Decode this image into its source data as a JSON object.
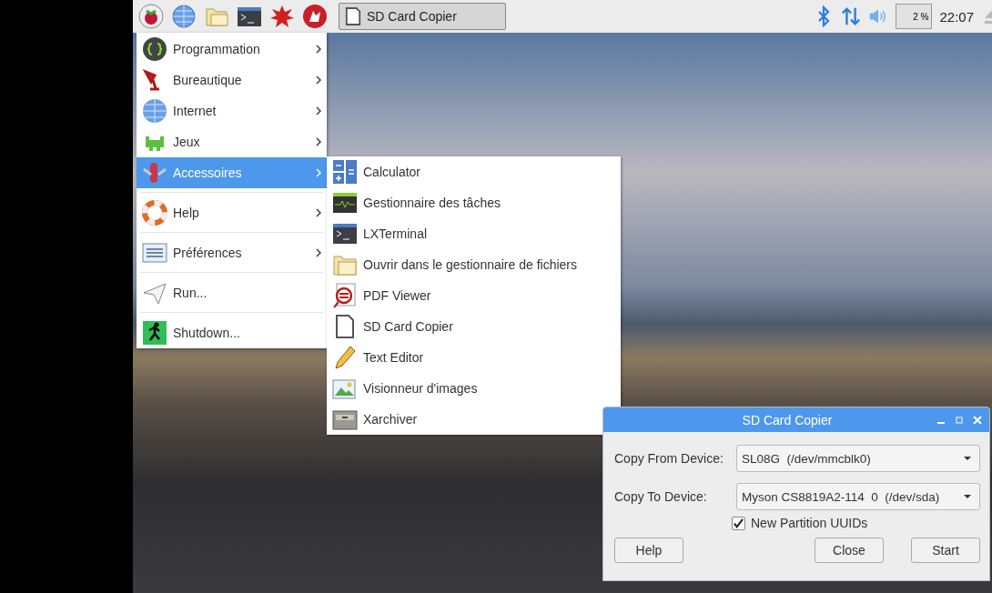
{
  "taskbar": {
    "task_button": {
      "label": "SD Card Copier",
      "selected": true
    },
    "cpu_monitor": {
      "reading": "2 %"
    },
    "clock": "22:07"
  },
  "main_menu": [
    {
      "label": "Programmation",
      "submenu": true,
      "selected": false,
      "separator_before": false
    },
    {
      "label": "Bureautique",
      "submenu": true,
      "selected": false,
      "separator_before": false
    },
    {
      "label": "Internet",
      "submenu": true,
      "selected": false,
      "separator_before": false
    },
    {
      "label": "Jeux",
      "submenu": true,
      "selected": false,
      "separator_before": false
    },
    {
      "label": "Accessoires",
      "submenu": true,
      "selected": true,
      "separator_before": false
    },
    {
      "label": "Help",
      "submenu": true,
      "selected": false,
      "separator_before": true
    },
    {
      "label": "Préférences",
      "submenu": true,
      "selected": false,
      "separator_before": true
    },
    {
      "label": "Run...",
      "submenu": false,
      "selected": false,
      "separator_before": true
    },
    {
      "label": "Shutdown...",
      "submenu": false,
      "selected": false,
      "separator_before": true
    }
  ],
  "submenu": [
    {
      "label": "Calculator"
    },
    {
      "label": "Gestionnaire des tâches"
    },
    {
      "label": "LXTerminal"
    },
    {
      "label": "Ouvrir dans le gestionnaire de fichiers"
    },
    {
      "label": "PDF Viewer"
    },
    {
      "label": "SD Card Copier"
    },
    {
      "label": "Text Editor"
    },
    {
      "label": "Visionneur d'images"
    },
    {
      "label": "Xarchiver"
    }
  ],
  "dialog": {
    "title": "SD Card Copier",
    "fields": [
      {
        "label": "Copy From Device:",
        "value": "SL08G  (/dev/mmcblk0)"
      },
      {
        "label": "Copy To Device:",
        "value": "Myson CS8819A2-114  0  (/dev/sda)"
      }
    ],
    "checkbox": {
      "label": "New Partition UUIDs",
      "checked": true
    },
    "buttons": [
      "Help",
      "Close",
      "Start"
    ]
  }
}
